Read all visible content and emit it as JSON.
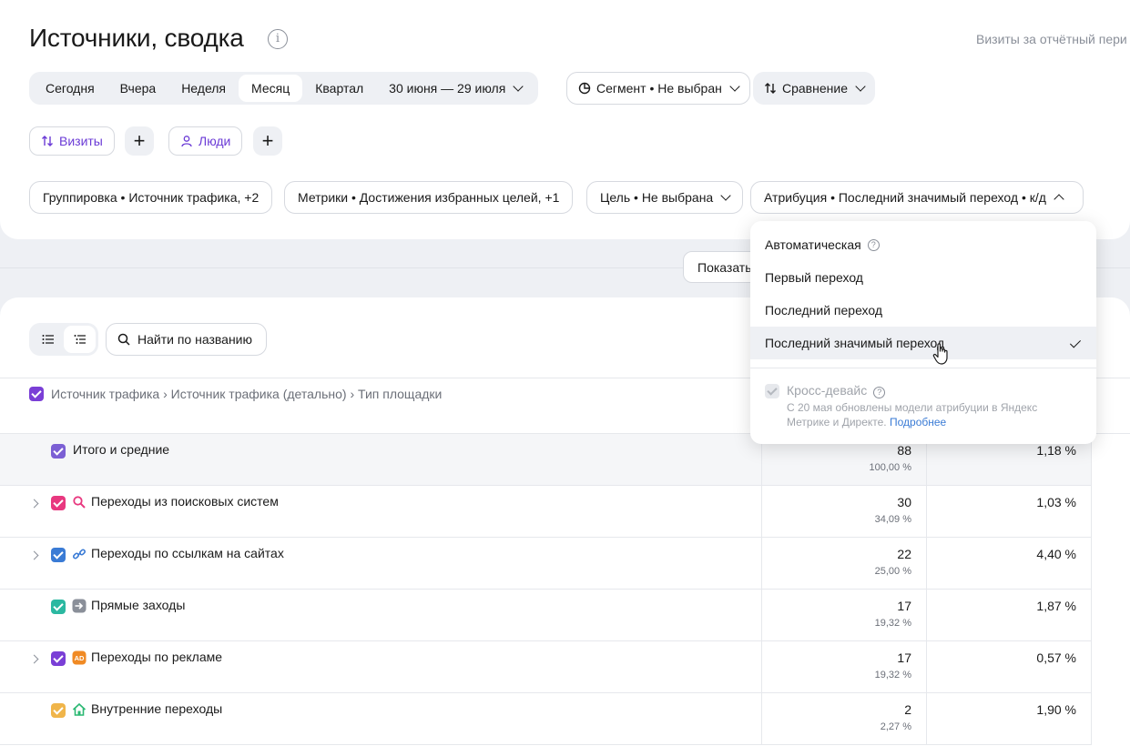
{
  "page": {
    "title": "Источники, сводка",
    "visits_period": "Визиты за отчётный пери"
  },
  "periods": {
    "today": "Сегодня",
    "yesterday": "Вчера",
    "week": "Неделя",
    "month": "Месяц",
    "quarter": "Квартал",
    "range": "30 июня — 29 июля",
    "active": "Месяц"
  },
  "segment": "Сегмент • Не выбран",
  "compare": "Сравнение",
  "tags": {
    "visits": "Визиты",
    "people": "Люди"
  },
  "filters": {
    "grouping": "Группировка • Источник трафика, +2",
    "metrics": "Метрики • Достижения избранных целей, +1",
    "goal": "Цель • Не выбрана",
    "attribution": "Атрибуция • Последний значимый переход • к/д"
  },
  "show_button": "Показать",
  "search": {
    "placeholder": "Найти по названию"
  },
  "group_header": "Источник трафика › Источник трафика (детально) › Тип площадки",
  "rows": [
    {
      "label": "Итого и средние",
      "v1": "88",
      "v2": "100,00 %",
      "v3": "1,18 %",
      "color": "#7b5fd4",
      "icon": "",
      "expandable": false
    },
    {
      "label": "Переходы из поисковых систем",
      "v1": "30",
      "v2": "34,09 %",
      "v3": "1,03 %",
      "color": "#e8387f",
      "icon": "search-icon",
      "expandable": true
    },
    {
      "label": "Переходы по ссылкам на сайтах",
      "v1": "22",
      "v2": "25,00 %",
      "v3": "4,40 %",
      "color": "#3a7bd5",
      "icon": "link-icon",
      "expandable": true
    },
    {
      "label": "Прямые заходы",
      "v1": "17",
      "v2": "19,32 %",
      "v3": "1,87 %",
      "color": "#2bb8a1",
      "icon": "direct-arrow-icon",
      "expandable": false
    },
    {
      "label": "Переходы по рекламе",
      "v1": "17",
      "v2": "19,32 %",
      "v3": "0,57 %",
      "color": "#7a3fd6",
      "icon": "ad-icon",
      "expandable": true
    },
    {
      "label": "Внутренние переходы",
      "v1": "2",
      "v2": "2,27 %",
      "v3": "1,90 %",
      "color": "#f0b54a",
      "icon": "home-icon",
      "expandable": false
    }
  ],
  "dropdown": {
    "items": [
      "Автоматическая",
      "Первый переход",
      "Последний переход",
      "Последний значимый переход"
    ],
    "selected": "Последний значимый переход",
    "cross_device": "Кросс-девайс",
    "cross_note": "С 20 мая обновлены модели атрибуции в Яндекс Метрике и Директе.",
    "more_link": "Подробнее"
  },
  "colors": {
    "accent_purple": "#6b3bd6",
    "link_blue": "#3a7bd5",
    "panel_bg": "#eef0f4"
  }
}
